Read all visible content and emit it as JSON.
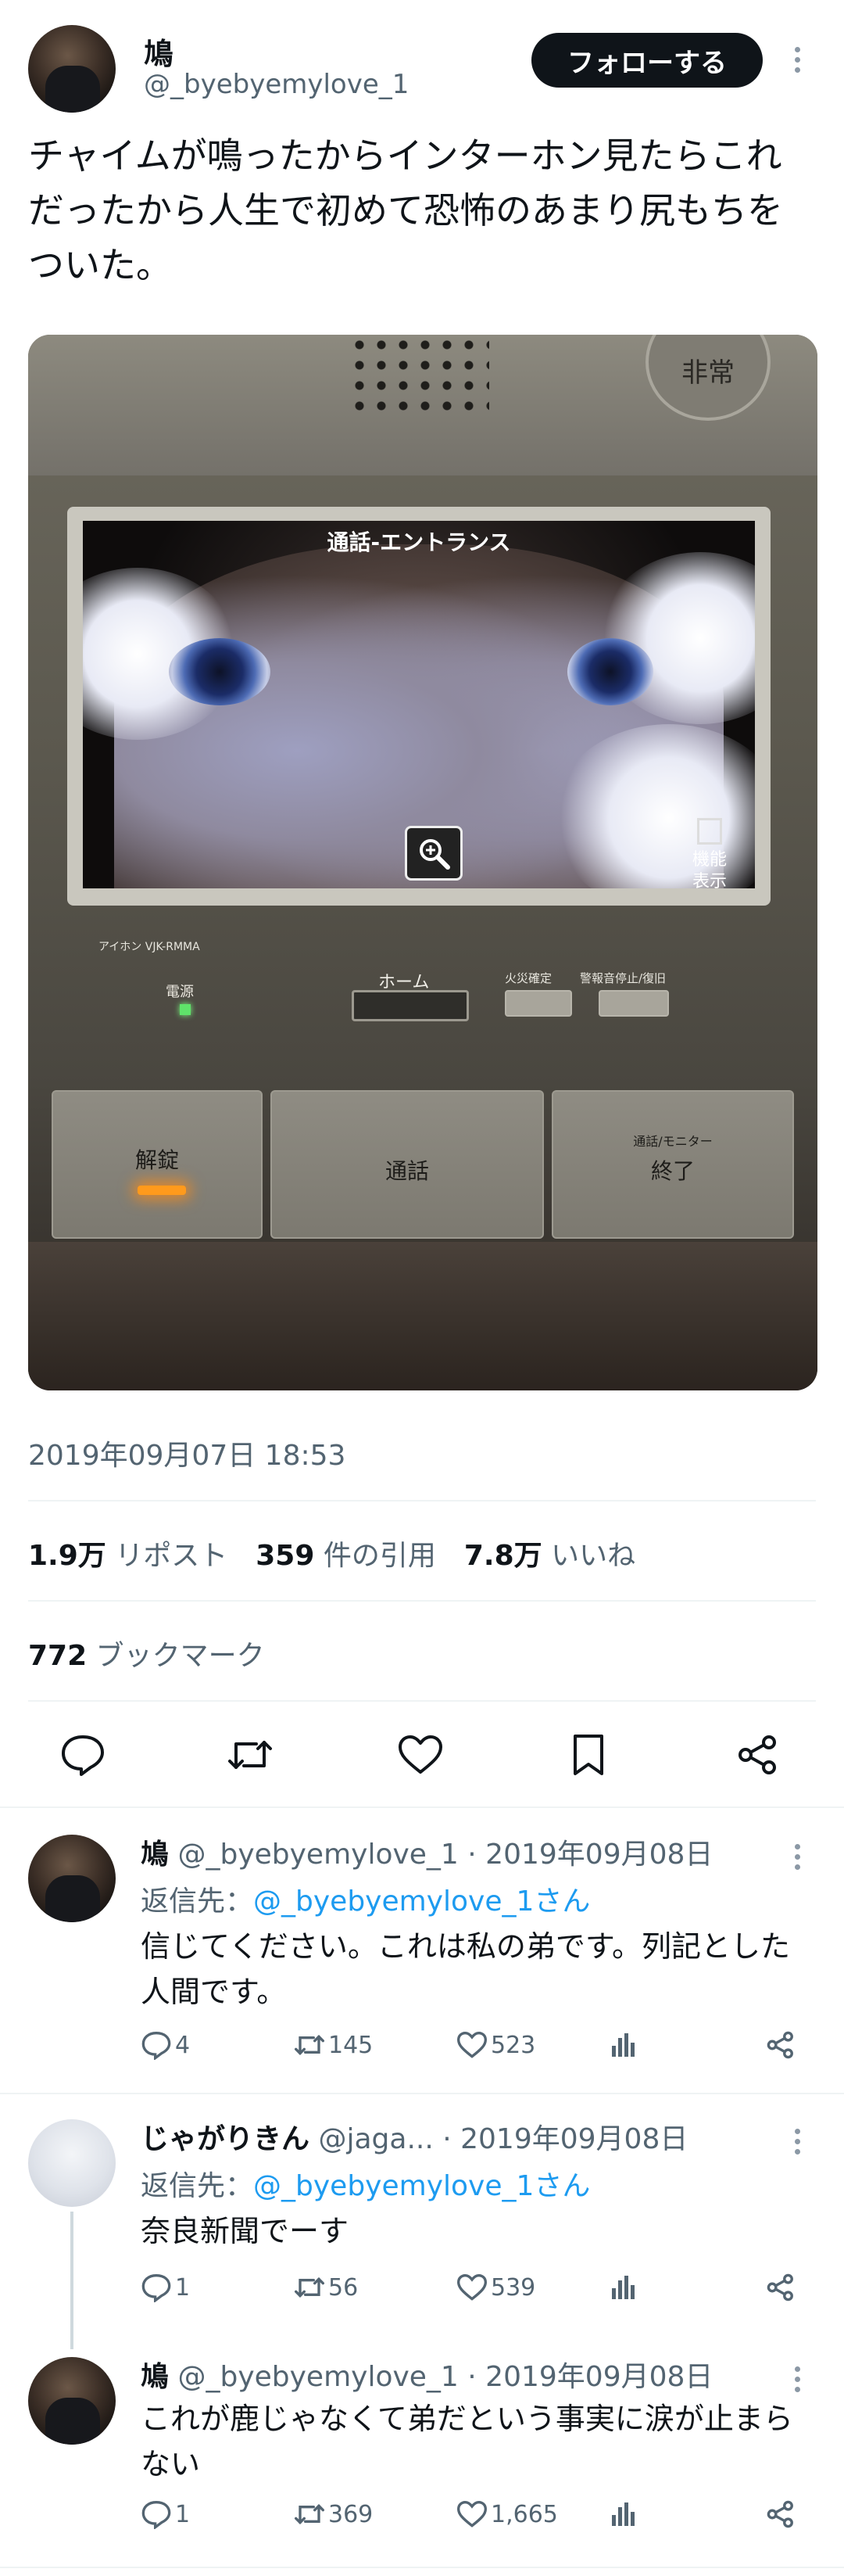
{
  "tweet": {
    "author_name": "鳩",
    "author_handle": "@_byebyemylove_1",
    "follow_label": "フォローする",
    "text": "チャイムが鳴ったからインターホン見たらこれだったから人生で初めて恐怖のあまり尻もちをついた。",
    "photo": {
      "hijo_label": "非常",
      "screen_title": "通話-エントランス",
      "kino_label_1": "機能",
      "kino_label_2": "表示",
      "maker_label": "アイホン VJK-RMMA",
      "dengen_label": "電源",
      "home_label": "ホーム",
      "btn_label_1": "火災確定",
      "btn_label_2": "警報音停止/復旧",
      "key_unlock": "解錠",
      "key_talk": "通話",
      "key_end": "終了",
      "key_end_small": "通話/モニター"
    },
    "timestamp": "2019年09月07日 18:53",
    "stats": {
      "reposts_value": "1.9万",
      "reposts_label": "リポスト",
      "quotes_value": "359",
      "quotes_label": "件の引用",
      "likes_value": "7.8万",
      "likes_label": "いいね"
    },
    "bookmarks_value": "772",
    "bookmarks_label": "ブックマーク"
  },
  "replies": [
    {
      "name": "鳩",
      "handle": "@_byebyemylove_1",
      "date": "· 2019年09月08日",
      "reply_to_prefix": "返信先：",
      "reply_to_mention": "@_byebyemylove_1さん",
      "text": "信じてください。これは私の弟です。列記とした人間です。",
      "replies": "4",
      "reposts": "145",
      "likes": "523"
    },
    {
      "name": "じゃがりきん",
      "handle": "@jaga...",
      "date": "· 2019年09月08日",
      "reply_to_prefix": "返信先：",
      "reply_to_mention": "@_byebyemylove_1さん",
      "text": "奈良新聞でーす",
      "replies": "1",
      "reposts": "56",
      "likes": "539"
    },
    {
      "name": "鳩",
      "handle": "@_byebyemylove_1",
      "date": "· 2019年09月08日",
      "text": "これが鹿じゃなくて弟だという事実に涙が止まらない",
      "replies": "1",
      "reposts": "369",
      "likes": "1,665"
    }
  ],
  "icons": {
    "reply": "speech-bubble-icon",
    "repost": "repost-arrows-icon",
    "like": "heart-icon",
    "bookmark": "bookmark-icon",
    "share": "share-icon",
    "views": "bar-chart-icon",
    "more": "more-vertical-icon"
  },
  "colors": {
    "text": "#0f1419",
    "secondary": "#536471",
    "link": "#1d9bf0",
    "follow_bg": "#0f1419"
  }
}
